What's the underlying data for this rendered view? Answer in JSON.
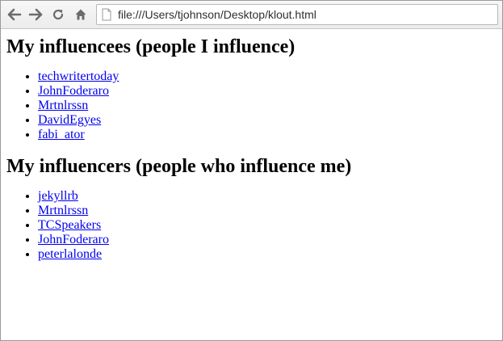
{
  "browser": {
    "url": "file:///Users/tjohnson/Desktop/klout.html",
    "buttons": [
      "back-icon",
      "forward-icon",
      "reload-icon",
      "home-icon"
    ]
  },
  "page": {
    "influencees": {
      "heading": "My influencees (people I influence)",
      "items": [
        "techwritertoday",
        "JohnFoderaro",
        "Mrtnlrssn",
        "DavidEgyes",
        "fabi_ator"
      ]
    },
    "influencers": {
      "heading": "My influencers (people who influence me)",
      "items": [
        "jekyllrb",
        "Mrtnlrssn",
        "TCSpeakers",
        "JohnFoderaro",
        "peterlalonde"
      ]
    }
  },
  "colors": {
    "link": "#0000ee",
    "toolbar": "#efefef",
    "icon": "#6b6b6b"
  }
}
